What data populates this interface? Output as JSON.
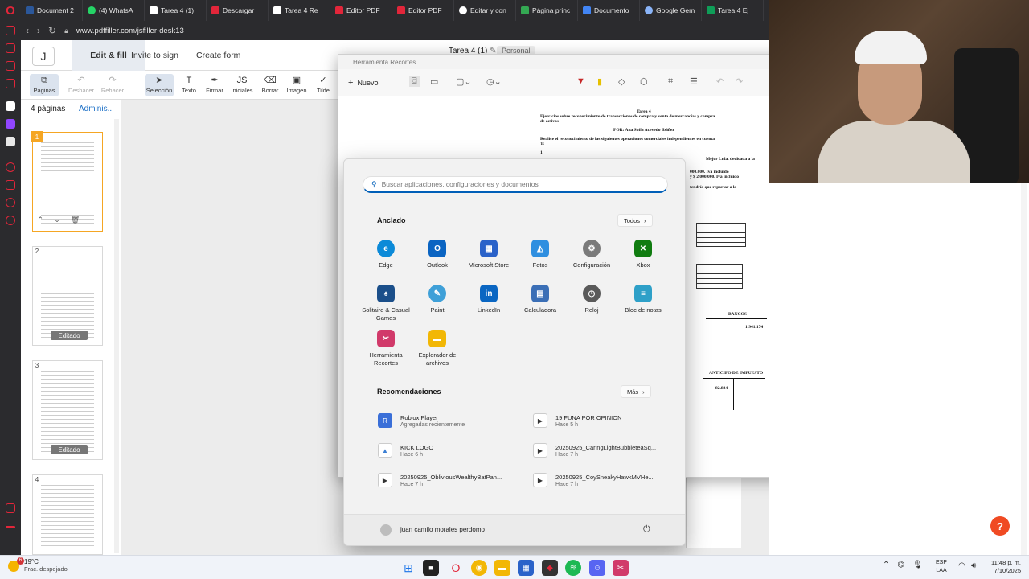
{
  "browser": {
    "tabs": [
      {
        "label": "Document 2",
        "color": "#2b579a"
      },
      {
        "label": "(4) WhatsA",
        "color": "#25d366"
      },
      {
        "label": "Tarea 4 (1)",
        "color": "#ffffff"
      },
      {
        "label": "Descargar",
        "color": "#e2263a"
      },
      {
        "label": "Tarea 4 Re",
        "color": "#ffffff"
      },
      {
        "label": "Editor PDF",
        "color": "#e2263a"
      },
      {
        "label": "Editor PDF",
        "color": "#e2263a"
      },
      {
        "label": "Editar y con",
        "color": "#ffffff"
      },
      {
        "label": "Página princ",
        "color": "#34a853"
      },
      {
        "label": "Documento",
        "color": "#4285f4"
      },
      {
        "label": "Google Gem",
        "color": "#8ab4f8"
      },
      {
        "label": "Tarea 4 Ej",
        "color": "#0f9d58"
      }
    ],
    "url": "www.pdffiller.com/jsfiller-desk13"
  },
  "pdffiller": {
    "j_label": "J",
    "tabs": {
      "edit": "Edit & fill",
      "invite": "Invite to sign",
      "create": "Create form"
    },
    "doc_title": "Tarea 4 (1)",
    "doc_title_suffix": "✎",
    "personal": "Personal",
    "tools": {
      "pages": "Páginas",
      "undo": "Deshacer",
      "redo": "Rehacer",
      "select": "Selección",
      "text": "Texto",
      "sign": "Firmar",
      "initials": "Iniciales",
      "erase": "Borrar",
      "image": "Imagen",
      "tick": "Tilde"
    },
    "pages_count": "4 páginas",
    "admin": "Adminis...",
    "edited": "Editado",
    "thumbs": [
      "1",
      "2",
      "3",
      "4"
    ]
  },
  "snip": {
    "title": "Herramienta Recortes",
    "new": "Nuevo"
  },
  "document": {
    "title": "Tarea 4",
    "heading1": "Ejercicios sobre reconocimiento de transacciones de compra y venta de mercancías y compra",
    "heading1b": "de activos",
    "author": "POR: Ana Sofía Acevedo Ibáñez",
    "intro": "Realice el reconocimiento de las siguientes operaciones comerciales independientes en cuenta",
    "intro_b": "T:",
    "item1": "1.",
    "frag1": "Mejor Ltda. dedicada a la",
    "frag2": "000.000. Iva incluido",
    "frag3": "y $ 2.000.000. Iva incluido",
    "frag4": "tendría que reportar a la",
    "bancos": "BANCOS",
    "bancos_val": "1'941.174",
    "anticipo": "ANTICIPO DE IMPUESTO",
    "anticipo_val": "82.824"
  },
  "start_menu": {
    "search_placeholder": "Buscar aplicaciones, configuraciones y documentos",
    "pinned_title": "Anclado",
    "all_button": "Todos",
    "pinned_apps": [
      {
        "label": "Edge",
        "icon": "edge-icon",
        "color": "#0c8ad8"
      },
      {
        "label": "Outlook",
        "icon": "outlook-icon",
        "color": "#0a64c2"
      },
      {
        "label": "Microsoft Store",
        "icon": "store-icon",
        "color": "#2a62c9"
      },
      {
        "label": "Fotos",
        "icon": "photos-icon",
        "color": "#2f8fe0"
      },
      {
        "label": "Configuración",
        "icon": "settings-icon",
        "color": "#7a7a7a"
      },
      {
        "label": "Xbox",
        "icon": "xbox-icon",
        "color": "#107c10"
      },
      {
        "label": "Solitaire & Casual Games",
        "icon": "solitaire-icon",
        "color": "#1b4f8a"
      },
      {
        "label": "Paint",
        "icon": "paint-icon",
        "color": "#3fa0d8"
      },
      {
        "label": "LinkedIn",
        "icon": "linkedin-icon",
        "color": "#0a66c2"
      },
      {
        "label": "Calculadora",
        "icon": "calculator-icon",
        "color": "#3b6fb6"
      },
      {
        "label": "Reloj",
        "icon": "clock-icon",
        "color": "#5a5a5a"
      },
      {
        "label": "Bloc de notas",
        "icon": "notepad-icon",
        "color": "#2ea0c8"
      },
      {
        "label": "Herramienta Recortes",
        "icon": "snipping-tool-icon",
        "color": "#d13a6a"
      },
      {
        "label": "Explorador de archivos",
        "icon": "file-explorer-icon",
        "color": "#f2b705"
      }
    ],
    "recommended_title": "Recomendaciones",
    "more_button": "Más",
    "recommended": [
      {
        "name": "Roblox Player",
        "time": "Agregadas recientemente",
        "icon": "roblox-icon",
        "color": "#3a6fd8"
      },
      {
        "name": "19 FUNA POR OPINION",
        "time": "Hace 5 h",
        "icon": "video-file-icon",
        "color": "#3a3a3a"
      },
      {
        "name": "KICK LOGO",
        "time": "Hace 6 h",
        "icon": "image-file-icon",
        "color": "#3b7fd4"
      },
      {
        "name": "20250925_CaringLightBubbleteaSq...",
        "time": "Hace 7 h",
        "icon": "video-file-icon",
        "color": "#3a3a3a"
      },
      {
        "name": "20250925_ObliviousWealthyBatPan...",
        "time": "Hace 7 h",
        "icon": "video-file-icon",
        "color": "#3a3a3a"
      },
      {
        "name": "20250925_CoySneakyHawkMVHe...",
        "time": "Hace 7 h",
        "icon": "video-file-icon",
        "color": "#3a3a3a"
      }
    ],
    "user_name": "juan camilo morales perdomo"
  },
  "taskbar": {
    "weather_temp": "19°C",
    "weather_desc": "Frac. despejado",
    "weather_badge": "6",
    "lang_line1": "ESP",
    "lang_line2": "LAA",
    "time": "11:48 p. m.",
    "date": "7/10/2025"
  }
}
